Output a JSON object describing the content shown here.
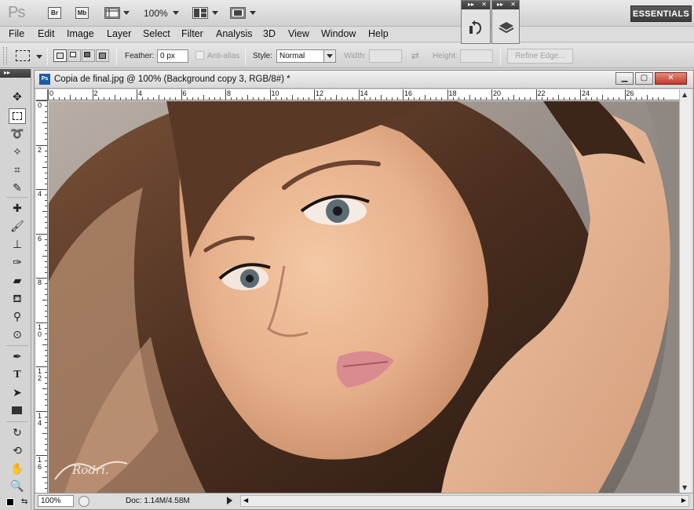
{
  "app": {
    "logo": "Ps",
    "bridge_button": "Br",
    "minibridge_button": "Mb",
    "zoom": "100%",
    "workspace": "ESSENTIALS"
  },
  "menu": [
    "File",
    "Edit",
    "Image",
    "Layer",
    "Select",
    "Filter",
    "Analysis",
    "3D",
    "View",
    "Window",
    "Help"
  ],
  "options": {
    "feather_label": "Feather:",
    "feather_value": "0 px",
    "antialias_label": "Anti-alias",
    "style_label": "Style:",
    "style_value": "Normal",
    "width_label": "Width:",
    "height_label": "Height:",
    "refine_label": "Refine Edge..."
  },
  "document": {
    "title": "Copia de final.jpg @ 100% (Background copy 3, RGB/8#) *",
    "ruler_h": [
      "0",
      "2",
      "4",
      "6",
      "8",
      "10",
      "12",
      "14",
      "16",
      "18",
      "20",
      "22",
      "24",
      "26"
    ],
    "ruler_v": [
      "0",
      "2",
      "4",
      "6",
      "8",
      "1 0",
      "1 2",
      "1 4",
      "1 6"
    ],
    "zoom": "100%",
    "doc_info": "Doc: 1.14M/4.58M",
    "signature": "Rodri."
  },
  "tools": [
    "move-tool",
    "marquee-tool",
    "lasso-tool",
    "quick-select-tool",
    "crop-tool",
    "eyedropper-tool",
    "healing-brush-tool",
    "brush-tool",
    "clone-stamp-tool",
    "history-brush-tool",
    "eraser-tool",
    "paint-bucket-tool",
    "dodge-tool",
    "burn-tool",
    "pen-tool",
    "type-tool",
    "path-selection-tool",
    "shape-tool",
    "3d-rotate-tool",
    "3d-orbit-tool",
    "hand-tool",
    "zoom-tool"
  ]
}
